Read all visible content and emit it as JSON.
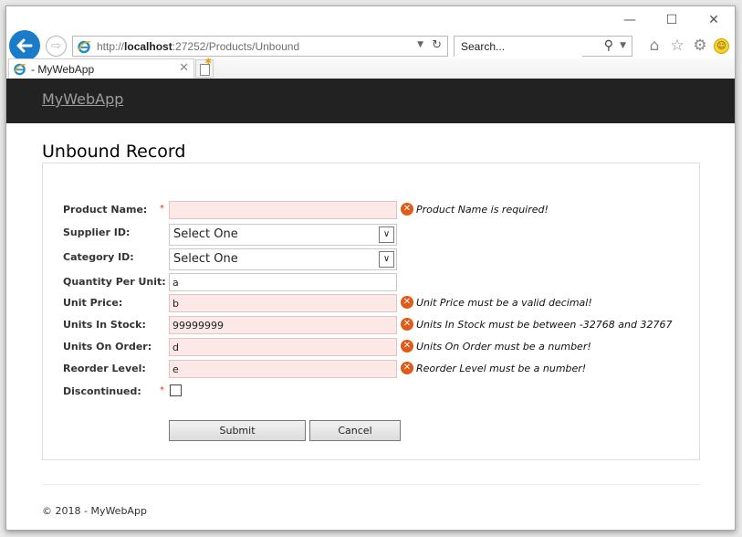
{
  "browser": {
    "url_prefix": "http://",
    "url_host": "localhost",
    "url_rest": ":27252/Products/Unbound",
    "search_placeholder": "Search...",
    "tab_title": "- MyWebApp",
    "window_controls": {
      "minimize": "—",
      "maximize": "☐",
      "close": "✕"
    }
  },
  "navbar": {
    "brand": "MyWebApp"
  },
  "page": {
    "title": "Unbound Record"
  },
  "form": {
    "fields": [
      {
        "label": "Product Name:",
        "required": true,
        "type": "text",
        "value": "",
        "error": "Product Name is required!"
      },
      {
        "label": "Supplier ID:",
        "type": "select",
        "value": "Select One"
      },
      {
        "label": "Category ID:",
        "type": "select",
        "value": "Select One"
      },
      {
        "label": "Quantity Per Unit:",
        "type": "text",
        "value": "a"
      },
      {
        "label": "Unit Price:",
        "type": "text",
        "value": "b",
        "error": "Unit Price must be a valid decimal!"
      },
      {
        "label": "Units In Stock:",
        "type": "text",
        "value": "99999999",
        "error": "Units In Stock must be between -32768 and 32767"
      },
      {
        "label": "Units On Order:",
        "type": "text",
        "value": "d",
        "error": "Units On Order must be a number!"
      },
      {
        "label": "Reorder Level:",
        "type": "text",
        "value": "e",
        "error": "Reorder Level must be a number!"
      },
      {
        "label": "Discontinued:",
        "required": true,
        "type": "checkbox",
        "checked": false
      }
    ],
    "required_marker": "*",
    "submit_label": "Submit",
    "cancel_label": "Cancel"
  },
  "footer": {
    "text": "© 2018 - MyWebApp"
  },
  "colors": {
    "navbar_bg": "#222222",
    "error_field_bg": "#fde8e8",
    "error_icon": "#e05a1a",
    "back_button": "#1a7bc9"
  }
}
